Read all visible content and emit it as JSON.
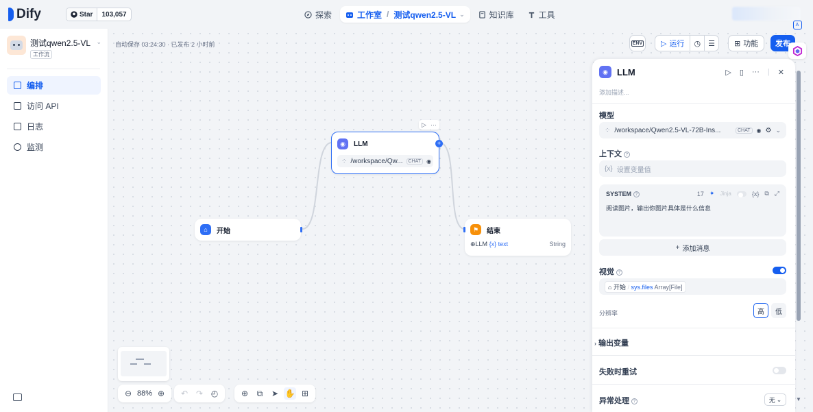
{
  "header": {
    "logo_text": "Dify",
    "github_star_label": "Star",
    "github_star_count": "103,057",
    "nav": {
      "explore": "探索",
      "studio": "工作室",
      "app_name": "测试qwen2.5-VL",
      "knowledge": "知识库",
      "tools": "工具"
    }
  },
  "sidebar": {
    "app_name": "测试qwen2.5-VL",
    "app_type": "工作流",
    "items": [
      {
        "label": "编排",
        "icon": "orchestrate-icon",
        "active": true
      },
      {
        "label": "访问 API",
        "icon": "api-icon",
        "active": false
      },
      {
        "label": "日志",
        "icon": "logs-icon",
        "active": false
      },
      {
        "label": "监测",
        "icon": "monitor-icon",
        "active": false
      }
    ]
  },
  "canvas": {
    "autosave_text": "自动保存 03:24:30 · 已发布 2 小时前",
    "zoom": "88%",
    "nodes": {
      "start": {
        "title": "开始"
      },
      "llm": {
        "title": "LLM",
        "model": "/workspace/Qw...",
        "model_tag": "CHAT"
      },
      "end": {
        "title": "结束",
        "source": "LLM",
        "var": "{x} text",
        "type": "String"
      }
    }
  },
  "toolbar": {
    "run_label": "运行",
    "features_label": "功能",
    "publish_label": "发布"
  },
  "panel": {
    "title": "LLM",
    "description_placeholder": "添加描述...",
    "model_label": "模型",
    "model_value": "/workspace/Qwen2.5-VL-72B-Ins...",
    "model_tag": "CHAT",
    "context_label": "上下文",
    "context_placeholder": "设置变量值",
    "system_label": "SYSTEM",
    "system_count": "17",
    "jinja_label": "Jinja",
    "system_text": "阅读图片，输出你图片具体是什么信息",
    "add_message": "添加消息",
    "vision_label": "视觉",
    "vision_node": "开始",
    "vision_var": "sys.files",
    "vision_type": "Array[File]",
    "resolution_label": "分辨率",
    "resolution_high": "高",
    "resolution_low": "低",
    "output_vars_label": "输出变量",
    "retry_label": "失败时重试",
    "error_handling_label": "异常处理",
    "error_handling_value": "无"
  },
  "colors": {
    "accent": "#155eef",
    "start_node": "#2e6ef5",
    "llm_node": "#6172f3",
    "end_node": "#f79009"
  }
}
